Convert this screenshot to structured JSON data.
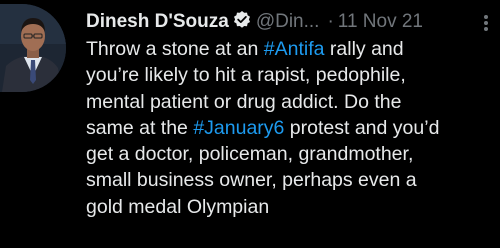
{
  "tweet": {
    "author": {
      "display_name": "Dinesh D'Souza",
      "handle": "@Din...",
      "verified_icon": "verified-badge-icon"
    },
    "separator": "·",
    "date": "11 Nov 21",
    "more_icon": "more-options-icon",
    "body_lines": [
      {
        "before": "Throw a stone at an ",
        "tag": "#Antifa",
        "after": " rally and"
      },
      {
        "before": "you’re likely to hit a rapist, pedophile,",
        "tag": "",
        "after": ""
      },
      {
        "before": "mental patient or drug addict. Do the",
        "tag": "",
        "after": ""
      },
      {
        "before": "same at the ",
        "tag": "#January6",
        "after": " protest and you’d"
      },
      {
        "before": "get a doctor, policeman, grandmother,",
        "tag": "",
        "after": ""
      },
      {
        "before": "small business owner, perhaps even a",
        "tag": "",
        "after": ""
      },
      {
        "before": "gold medal Olympian",
        "tag": "",
        "after": ""
      }
    ]
  },
  "colors": {
    "background": "#000000",
    "text": "#e7e9ea",
    "secondary": "#71767b",
    "link": "#1d9bf0",
    "verified": "#e7e9ea"
  }
}
